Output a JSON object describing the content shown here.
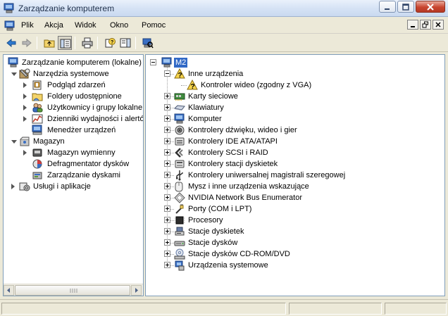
{
  "window": {
    "title": "Zarządzanie komputerem"
  },
  "menu": {
    "items": [
      "Plik",
      "Akcja",
      "Widok",
      "Okno",
      "Pomoc"
    ]
  },
  "left_tree": {
    "root": "Zarządzanie komputerem (lokalne)",
    "groups": [
      {
        "label": "Narzędzia systemowe",
        "children": [
          "Podgląd zdarzeń",
          "Foldery udostępnione",
          "Użytkownicy i grupy lokalne",
          "Dzienniki wydajności i alertów",
          "Menedżer urządzeń"
        ]
      },
      {
        "label": "Magazyn",
        "children": [
          "Magazyn wymienny",
          "Defragmentator dysków",
          "Zarządzanie dyskami"
        ]
      },
      {
        "label": "Usługi i aplikacje",
        "children": []
      }
    ]
  },
  "device_tree": {
    "computer": "M2",
    "categories": [
      {
        "label": "Inne urządzenia",
        "expanded": true,
        "children": [
          "Kontroler wideo (zgodny z VGA)"
        ]
      },
      {
        "label": "Karty sieciowe"
      },
      {
        "label": "Klawiatury"
      },
      {
        "label": "Komputer"
      },
      {
        "label": "Kontrolery dźwięku, wideo i gier"
      },
      {
        "label": "Kontrolery IDE ATA/ATAPI"
      },
      {
        "label": "Kontrolery SCSI i RAID"
      },
      {
        "label": "Kontrolery stacji dyskietek"
      },
      {
        "label": "Kontrolery uniwersalnej magistrali szeregowej"
      },
      {
        "label": "Mysz i inne urządzenia wskazujące"
      },
      {
        "label": "NVIDIA Network Bus Enumerator"
      },
      {
        "label": "Porty (COM i LPT)"
      },
      {
        "label": "Procesory"
      },
      {
        "label": "Stacje dyskietek"
      },
      {
        "label": "Stacje dysków"
      },
      {
        "label": "Stacje dysków CD-ROM/DVD"
      },
      {
        "label": "Urządzenia systemowe"
      }
    ]
  },
  "icons": {
    "category_icons": [
      "warning-question-icon",
      "network-card-icon",
      "keyboard-icon",
      "computer-icon",
      "sound-icon",
      "ide-controller-icon",
      "scsi-icon",
      "floppy-controller-icon",
      "usb-icon",
      "mouse-icon",
      "nvidia-icon",
      "port-icon",
      "processor-icon",
      "floppy-drive-icon",
      "disk-drive-icon",
      "cdrom-icon",
      "system-device-icon"
    ]
  },
  "colors": {
    "selection": "#3169c6",
    "title_bar": "#d6e3f5",
    "close_button": "#c8442f"
  }
}
